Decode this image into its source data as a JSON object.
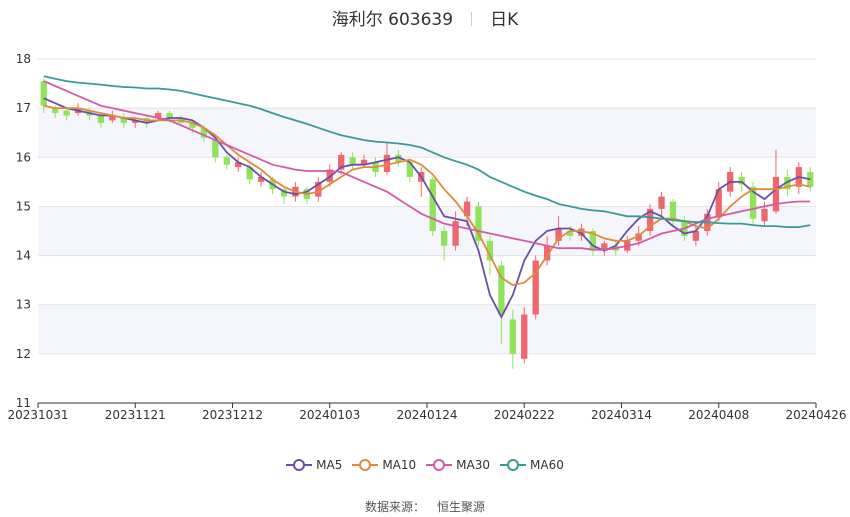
{
  "header": {
    "name": "海利尔 603639",
    "period": "日K"
  },
  "footer": {
    "source_label": "数据来源：",
    "source_name": "恒生聚源"
  },
  "chart_data": {
    "type": "candlestick",
    "ylim": [
      11,
      18
    ],
    "y_ticks": [
      11,
      12,
      13,
      14,
      15,
      16,
      17,
      18
    ],
    "x_tick_labels": [
      "20231031",
      "20231121",
      "20231212",
      "20240103",
      "20240124",
      "20240222",
      "20240314",
      "20240408",
      "20240426"
    ],
    "colors": {
      "up": "#f0666e",
      "down": "#8fe35a",
      "band": "#f4f6fb",
      "grid": "#e3e3e3"
    },
    "series": [
      {
        "name": "MA5",
        "color": "#6a4fa8",
        "values": [
          17.2,
          17.1,
          17.0,
          16.95,
          16.9,
          16.85,
          16.85,
          16.8,
          16.75,
          16.7,
          16.75,
          16.8,
          16.8,
          16.75,
          16.6,
          16.4,
          16.1,
          15.9,
          15.8,
          15.6,
          15.45,
          15.3,
          15.25,
          15.3,
          15.45,
          15.6,
          15.8,
          15.85,
          15.85,
          15.9,
          15.95,
          16.0,
          15.9,
          15.6,
          15.2,
          14.8,
          14.75,
          14.7,
          14.1,
          13.2,
          12.75,
          13.2,
          13.9,
          14.3,
          14.5,
          14.55,
          14.55,
          14.45,
          14.2,
          14.1,
          14.2,
          14.5,
          14.75,
          14.9,
          14.8,
          14.6,
          14.45,
          14.5,
          14.8,
          15.35,
          15.5,
          15.5,
          15.3,
          15.15,
          15.35,
          15.5,
          15.6,
          15.55
        ]
      },
      {
        "name": "MA10",
        "color": "#e08a3a",
        "values": [
          17.05,
          17.0,
          17.0,
          17.0,
          16.95,
          16.9,
          16.85,
          16.8,
          16.8,
          16.75,
          16.75,
          16.75,
          16.75,
          16.7,
          16.6,
          16.45,
          16.25,
          16.05,
          15.9,
          15.75,
          15.55,
          15.4,
          15.3,
          15.25,
          15.3,
          15.45,
          15.6,
          15.75,
          15.8,
          15.8,
          15.85,
          15.9,
          15.95,
          15.85,
          15.65,
          15.35,
          15.1,
          14.8,
          14.45,
          14.0,
          13.55,
          13.4,
          13.45,
          13.65,
          14.0,
          14.35,
          14.5,
          14.5,
          14.45,
          14.35,
          14.3,
          14.3,
          14.4,
          14.6,
          14.75,
          14.75,
          14.7,
          14.6,
          14.55,
          14.75,
          15.0,
          15.2,
          15.35,
          15.35,
          15.35,
          15.4,
          15.45,
          15.4
        ]
      },
      {
        "name": "MA30",
        "color": "#d45aa8",
        "values": [
          17.55,
          17.45,
          17.35,
          17.25,
          17.15,
          17.05,
          17.0,
          16.95,
          16.9,
          16.85,
          16.8,
          16.75,
          16.65,
          16.55,
          16.45,
          16.35,
          16.25,
          16.15,
          16.05,
          15.95,
          15.85,
          15.8,
          15.75,
          15.72,
          15.72,
          15.72,
          15.7,
          15.6,
          15.5,
          15.4,
          15.3,
          15.15,
          15.0,
          14.85,
          14.75,
          14.65,
          14.6,
          14.55,
          14.5,
          14.45,
          14.4,
          14.35,
          14.3,
          14.25,
          14.2,
          14.15,
          14.15,
          14.15,
          14.12,
          14.12,
          14.15,
          14.2,
          14.25,
          14.35,
          14.45,
          14.5,
          14.55,
          14.65,
          14.75,
          14.8,
          14.85,
          14.9,
          14.95,
          15.0,
          15.05,
          15.08,
          15.1,
          15.1
        ]
      },
      {
        "name": "MA60",
        "color": "#3a9a98",
        "values": [
          17.65,
          17.6,
          17.55,
          17.52,
          17.5,
          17.48,
          17.45,
          17.43,
          17.42,
          17.4,
          17.4,
          17.38,
          17.35,
          17.3,
          17.25,
          17.2,
          17.15,
          17.1,
          17.05,
          16.98,
          16.9,
          16.82,
          16.75,
          16.68,
          16.6,
          16.52,
          16.45,
          16.4,
          16.35,
          16.32,
          16.3,
          16.28,
          16.25,
          16.2,
          16.1,
          16.0,
          15.92,
          15.85,
          15.75,
          15.6,
          15.5,
          15.4,
          15.3,
          15.22,
          15.15,
          15.05,
          15.0,
          14.95,
          14.92,
          14.9,
          14.85,
          14.8,
          14.8,
          14.78,
          14.75,
          14.72,
          14.7,
          14.68,
          14.68,
          14.66,
          14.65,
          14.65,
          14.62,
          14.6,
          14.6,
          14.58,
          14.58,
          14.62
        ]
      }
    ],
    "candles": [
      [
        17.55,
        17.05,
        17.6,
        16.9
      ],
      [
        17.0,
        16.9,
        17.05,
        16.8
      ],
      [
        16.95,
        16.85,
        17.0,
        16.75
      ],
      [
        16.9,
        17.0,
        17.1,
        16.85
      ],
      [
        16.95,
        16.85,
        17.0,
        16.75
      ],
      [
        16.85,
        16.7,
        16.9,
        16.6
      ],
      [
        16.75,
        16.85,
        16.95,
        16.7
      ],
      [
        16.8,
        16.7,
        16.9,
        16.6
      ],
      [
        16.7,
        16.75,
        16.8,
        16.6
      ],
      [
        16.8,
        16.7,
        16.85,
        16.6
      ],
      [
        16.8,
        16.9,
        16.95,
        16.75
      ],
      [
        16.9,
        16.8,
        16.95,
        16.7
      ],
      [
        16.8,
        16.7,
        16.85,
        16.65
      ],
      [
        16.7,
        16.6,
        16.75,
        16.5
      ],
      [
        16.6,
        16.4,
        16.65,
        16.3
      ],
      [
        16.35,
        16.0,
        16.4,
        15.9
      ],
      [
        16.0,
        15.85,
        16.05,
        15.75
      ],
      [
        15.8,
        15.9,
        16.0,
        15.7
      ],
      [
        15.8,
        15.55,
        15.85,
        15.45
      ],
      [
        15.5,
        15.6,
        15.7,
        15.4
      ],
      [
        15.55,
        15.35,
        15.6,
        15.25
      ],
      [
        15.35,
        15.2,
        15.4,
        15.05
      ],
      [
        15.2,
        15.4,
        15.5,
        15.1
      ],
      [
        15.35,
        15.15,
        15.4,
        15.05
      ],
      [
        15.2,
        15.5,
        15.6,
        15.1
      ],
      [
        15.5,
        15.75,
        15.85,
        15.4
      ],
      [
        15.75,
        16.05,
        16.1,
        15.65
      ],
      [
        16.0,
        15.85,
        16.1,
        15.75
      ],
      [
        15.85,
        15.95,
        16.05,
        15.8
      ],
      [
        15.9,
        15.7,
        16.0,
        15.6
      ],
      [
        15.7,
        16.05,
        16.3,
        15.65
      ],
      [
        16.05,
        15.9,
        16.15,
        15.8
      ],
      [
        15.9,
        15.6,
        15.95,
        15.5
      ],
      [
        15.5,
        15.7,
        15.8,
        15.2
      ],
      [
        15.55,
        14.5,
        15.6,
        14.4
      ],
      [
        14.5,
        14.2,
        14.6,
        13.9
      ],
      [
        14.2,
        14.7,
        14.9,
        14.1
      ],
      [
        14.8,
        15.1,
        15.2,
        14.6
      ],
      [
        15.0,
        14.3,
        15.1,
        14.2
      ],
      [
        14.3,
        13.9,
        14.4,
        13.6
      ],
      [
        13.8,
        12.8,
        13.9,
        12.2
      ],
      [
        12.7,
        12.0,
        12.9,
        11.7
      ],
      [
        11.9,
        12.8,
        12.95,
        11.8
      ],
      [
        12.8,
        13.9,
        14.0,
        12.7
      ],
      [
        13.9,
        14.2,
        14.4,
        13.8
      ],
      [
        14.3,
        14.55,
        14.8,
        14.2
      ],
      [
        14.5,
        14.4,
        14.6,
        14.3
      ],
      [
        14.4,
        14.55,
        14.65,
        14.3
      ],
      [
        14.5,
        14.1,
        14.55,
        14.0
      ],
      [
        14.1,
        14.25,
        14.3,
        14.0
      ],
      [
        14.2,
        14.1,
        14.3,
        14.0
      ],
      [
        14.1,
        14.3,
        14.4,
        14.05
      ],
      [
        14.3,
        14.45,
        14.6,
        14.2
      ],
      [
        14.5,
        14.95,
        15.05,
        14.4
      ],
      [
        14.95,
        15.2,
        15.3,
        14.8
      ],
      [
        15.1,
        14.75,
        15.15,
        14.6
      ],
      [
        14.7,
        14.4,
        14.8,
        14.3
      ],
      [
        14.3,
        14.5,
        14.6,
        14.2
      ],
      [
        14.5,
        14.85,
        14.95,
        14.4
      ],
      [
        14.8,
        15.35,
        15.5,
        14.7
      ],
      [
        15.3,
        15.7,
        15.8,
        15.2
      ],
      [
        15.6,
        15.45,
        15.7,
        15.3
      ],
      [
        15.4,
        14.75,
        15.5,
        14.6
      ],
      [
        14.7,
        14.95,
        15.1,
        14.6
      ],
      [
        14.9,
        15.6,
        16.15,
        14.85
      ],
      [
        15.6,
        15.35,
        15.75,
        15.2
      ],
      [
        15.4,
        15.8,
        15.9,
        15.25
      ],
      [
        15.7,
        15.4,
        15.8,
        15.3
      ]
    ]
  }
}
